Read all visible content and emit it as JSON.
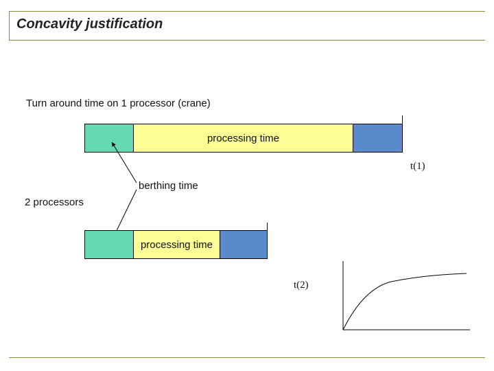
{
  "title": "Concavity justification",
  "subtitle": "Turn around time on 1 processor (crane)",
  "bar1": {
    "processing_label": "processing time",
    "t_label": "t(1)"
  },
  "berthing_label": "berthing time",
  "processors2_label": "2 processors",
  "bar2": {
    "processing_label": "processing time",
    "t_label": "t(2)"
  },
  "chart_data": {
    "type": "line",
    "title": "",
    "xlabel": "",
    "ylabel": "",
    "x": [
      0,
      1,
      2,
      3,
      4,
      5
    ],
    "values": [
      0,
      55,
      75,
      85,
      90,
      92
    ],
    "ylim": [
      0,
      100
    ],
    "xlim": [
      0,
      5
    ]
  }
}
